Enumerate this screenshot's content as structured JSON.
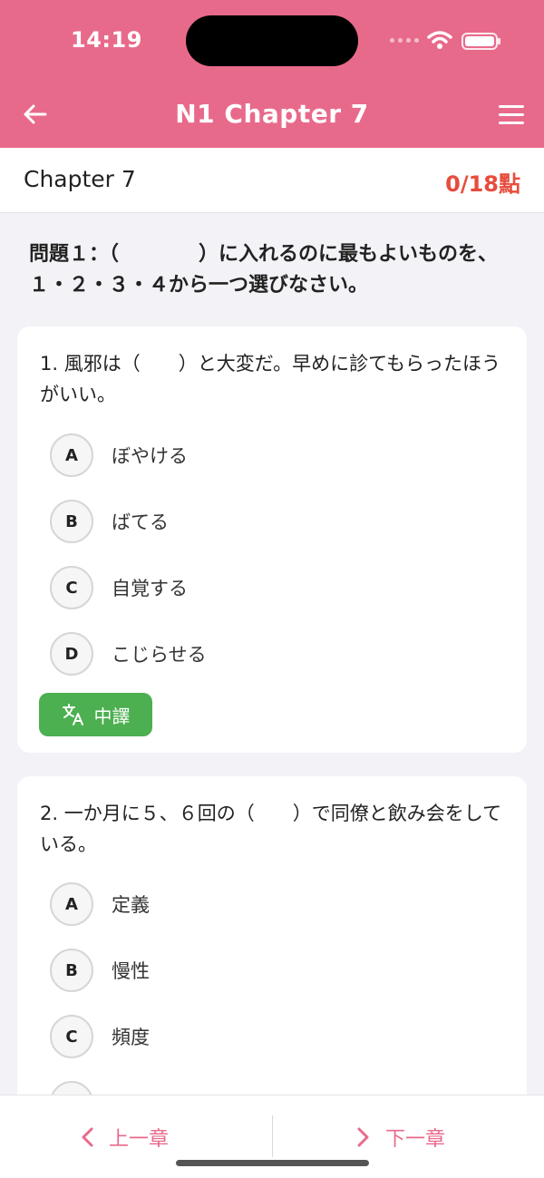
{
  "status": {
    "time": "14:19"
  },
  "header": {
    "title": "N1 Chapter 7"
  },
  "chapter": {
    "name": "Chapter 7",
    "score": "0/18點"
  },
  "instruction": "問題１：（　　　　）に入れるのに最もよいものを、１・２・３・４から一つ選びなさい。",
  "questions": [
    {
      "text": "1. 風邪は（　　）と大変だ。早めに診てもらったほうがいい。",
      "options": [
        {
          "letter": "A",
          "text": "ぼやける"
        },
        {
          "letter": "B",
          "text": "ばてる"
        },
        {
          "letter": "C",
          "text": "自覚する"
        },
        {
          "letter": "D",
          "text": "こじらせる"
        }
      ],
      "translate_label": "中譯"
    },
    {
      "text": "2. 一か月に５、６回の（　　）で同僚と飲み会をしている。",
      "options": [
        {
          "letter": "A",
          "text": "定義"
        },
        {
          "letter": "B",
          "text": "慢性"
        },
        {
          "letter": "C",
          "text": "頻度"
        }
      ]
    }
  ],
  "bottom_nav": {
    "prev_label": "上一章",
    "next_label": "下一章"
  },
  "colors": {
    "brand": "#e86a8b",
    "score": "#e74c3c",
    "translate": "#4caf50"
  },
  "icons": {
    "back": "arrow-left-icon",
    "menu": "hamburger-menu-icon",
    "translate": "translate-icon",
    "prev": "chevron-left-icon",
    "next": "chevron-right-icon"
  }
}
